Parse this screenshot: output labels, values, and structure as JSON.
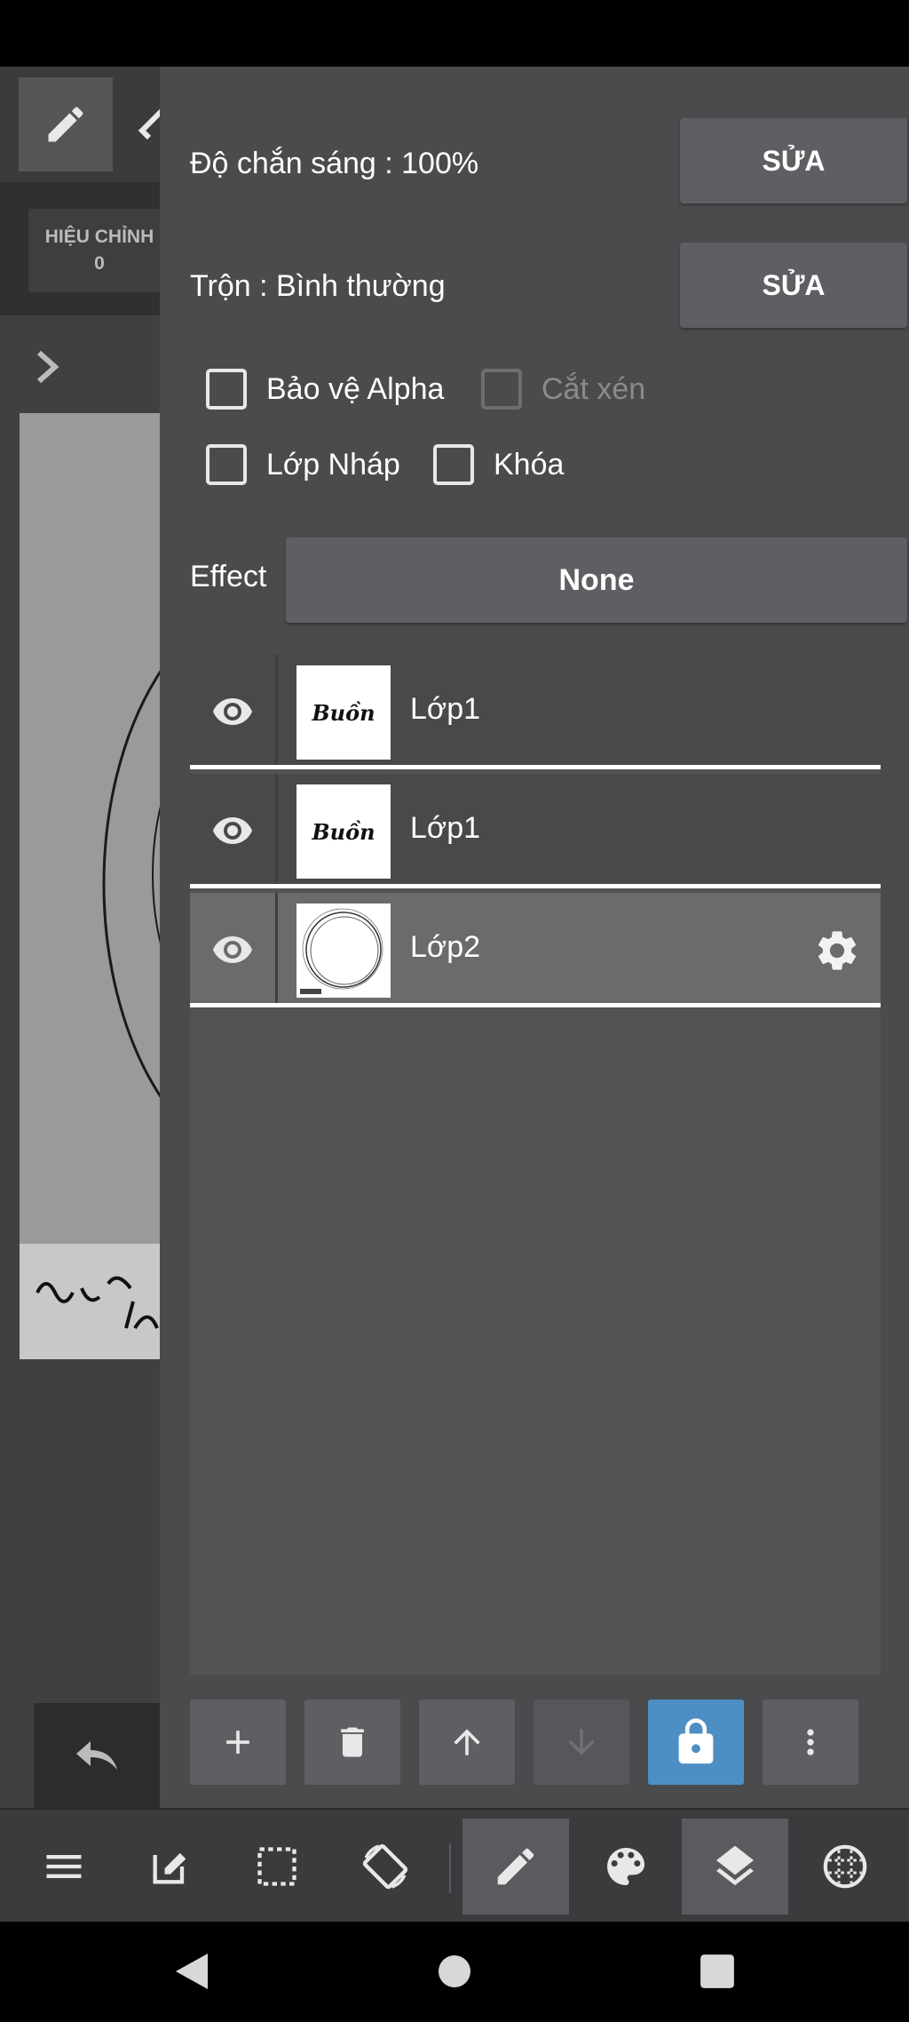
{
  "colors": {
    "panel_bg": "#4a4b4d",
    "button_bg": "#5e5f62",
    "lock_active": "#4d8fc4",
    "selected_row": "#6b6b6c"
  },
  "background_app": {
    "adjust_label": "HIỆU CHỈNH",
    "adjust_value": "0"
  },
  "layer_panel": {
    "opacity_label": "Độ chắn sáng : 100%",
    "opacity_edit": "SỬA",
    "blend_label": "Trộn : Bình thường",
    "blend_edit": "SỬA",
    "checkboxes": [
      {
        "label": "Bảo vệ Alpha",
        "checked": false,
        "enabled": true
      },
      {
        "label": "Cắt xén",
        "checked": false,
        "enabled": false
      },
      {
        "label": "Lớp Nháp",
        "checked": false,
        "enabled": true
      },
      {
        "label": "Khóa",
        "checked": false,
        "enabled": true
      }
    ],
    "effect_label": "Effect",
    "effect_value": "None",
    "layers": [
      {
        "name": "Lớp1",
        "visible": true,
        "thumb_text": "Buồn",
        "selected": false
      },
      {
        "name": "Lớp1",
        "visible": true,
        "thumb_text": "Buồn",
        "selected": false
      },
      {
        "name": "Lớp2",
        "visible": true,
        "thumb_text": "",
        "selected": true
      }
    ],
    "actions": [
      "add-icon",
      "trash-icon",
      "arrow-up-icon",
      "arrow-down-icon",
      "lock-icon",
      "more-vertical-icon"
    ]
  },
  "bottom_bar": [
    "menu-icon",
    "edit-icon",
    "selection-icon",
    "rotate-icon",
    "pencil-icon",
    "palette-icon",
    "layers-icon",
    "grid-icon"
  ],
  "nav_bar": [
    "back-icon",
    "home-icon",
    "recents-icon"
  ]
}
